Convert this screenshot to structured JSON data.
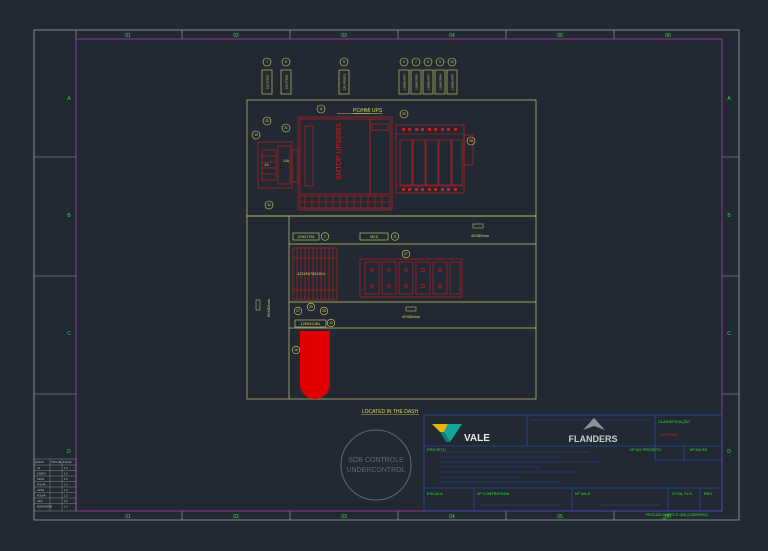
{
  "colors": {
    "background": "#222933",
    "frame": "#9aa69a",
    "border_inner": "#b03cb0",
    "zone": "#33e033",
    "panel": "#c8c86a",
    "component": "#d01e1e",
    "label_box": "#d8d860",
    "blue": "#2a52c8",
    "watermark": "#5f6872"
  },
  "zones": {
    "columns": [
      "01",
      "02",
      "03",
      "04",
      "05",
      "06"
    ],
    "rows": [
      "A",
      "B",
      "C",
      "D"
    ]
  },
  "top_labels": {
    "relays": [
      "1SL0TEB1",
      "1SL0TEB1",
      "1SLVPSG11",
      "1ZMGC0R1",
      "1ZMGC0R2",
      "1ZMGC0R3",
      "1ZMGC0R4",
      "1ZMGC0R5"
    ],
    "balloons": [
      "7",
      "8",
      "9",
      "6",
      "7",
      "8",
      "9",
      "10"
    ]
  },
  "panel": {
    "title": "PC/HMI UPS",
    "ups_label": "SMTDP UPS600S",
    "dim_upper": "40X80mm",
    "dim_lower": "40X60mm",
    "dim_side": "60X80mm",
    "terminal_label": "12M01TB1",
    "mk_label": "MK8",
    "connector_label": "12M01CJB1",
    "terminal_numbers": "1234567891011",
    "balloons": {
      "b11": "11",
      "b22": "22",
      "b21": "21",
      "b19": "19",
      "b13": "13",
      "b10a": "10A",
      "b20": "20",
      "b26": "26",
      "b30": "30",
      "b2": "2",
      "b11b": "11",
      "b27": "27",
      "b27b": "27",
      "b28": "28",
      "b29": "29",
      "b13b": "13",
      "b16": "16"
    },
    "located": "LOCATED IN THE DASH"
  },
  "revision_table": {
    "headers": [
      "QUANT.",
      "TIPO DE",
      "FOLHA"
    ],
    "rows": [
      [
        "A1",
        "",
        "1.0"
      ],
      [
        "CAPA A",
        "",
        "1.0"
      ],
      [
        "A2/A3",
        "",
        "1.0"
      ],
      [
        "FOLHA",
        "",
        "1.0"
      ],
      [
        "A3/A4",
        "",
        "1.0"
      ],
      [
        "FOLHA",
        "",
        "1.0"
      ],
      [
        "A4/A",
        "",
        "1.0"
      ],
      [
        "MONTAGEM",
        "",
        "1.0"
      ]
    ]
  },
  "watermark": {
    "line1": "SOB CONTROLE",
    "line2": "UNDERCONTROL"
  },
  "title_block": {
    "logo_vale": "VALE",
    "logo_flanders": "FLANDERS",
    "classificacao": "CLASSIFICAÇÃO",
    "interna": "INTERNA",
    "projeto": "PROJETO",
    "n_do_projeto": "Nº DO PROJETO",
    "n_da_se": "Nº DA SE",
    "escala": "ESCALA",
    "n_contratada": "Nº CONTRATADA",
    "n_vale": "Nº VALE",
    "total_fls": "TOTAL FLS.",
    "rev": "REV",
    "doc_number": "PR-E-022 ANEXO E (A3) (CADERNO)",
    "doc_sub": "06"
  }
}
